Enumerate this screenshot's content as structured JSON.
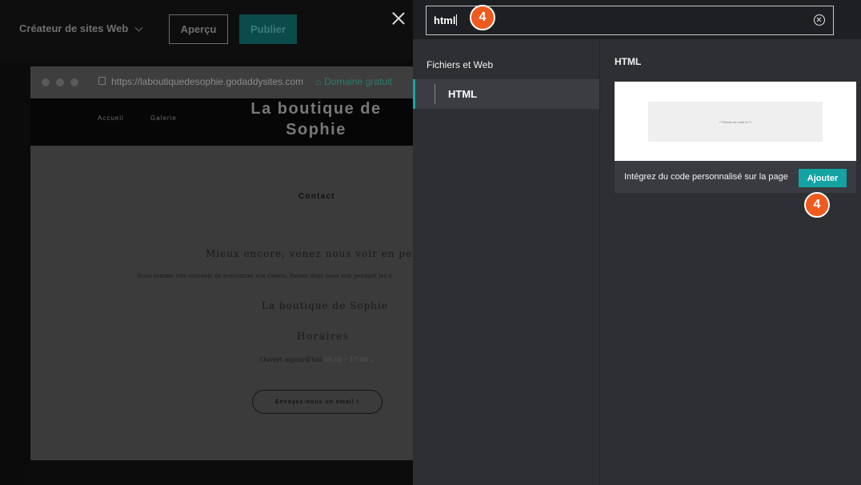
{
  "editor": {
    "site_switcher": "Créateur de sites Web",
    "preview_button": "Aperçu",
    "publish_button": "Publier"
  },
  "browser": {
    "url": "https://laboutiquedesophie.godaddysites.com",
    "free_domain": "Domaine gratuit"
  },
  "site": {
    "nav": [
      "Accueil",
      "Galerie"
    ],
    "title_line1": "La boutique de",
    "title_line2": "Sophie",
    "contact_heading": "Contact",
    "tagline": "Mieux encore, venez nous voir en person",
    "intro": "Nous somme très contents de rencontrer nos clients. Passez donc nous voir pendant les h",
    "business_name": "La boutique de Sophie",
    "hours_heading": "Horaires",
    "open_today_label": "Ouvert aujourd'hui",
    "open_today_hours": "09:00 – 17:00",
    "email_button": "Envoyez-nous un email !"
  },
  "panel": {
    "search": {
      "value": "html"
    },
    "categories_heading": "Fichiers et Web",
    "categories": [
      {
        "label": "HTML",
        "selected": true
      }
    ],
    "section_heading": "HTML",
    "card": {
      "preview_text": "/* Rendu du code ici */",
      "description": "Intégrez du code personnalisé sur la page",
      "add_button": "Ajouter"
    }
  },
  "badges": {
    "search_step": "4",
    "add_step": "4"
  },
  "colors": {
    "accent": "#14a3a3",
    "badge": "#ef5a1e"
  }
}
